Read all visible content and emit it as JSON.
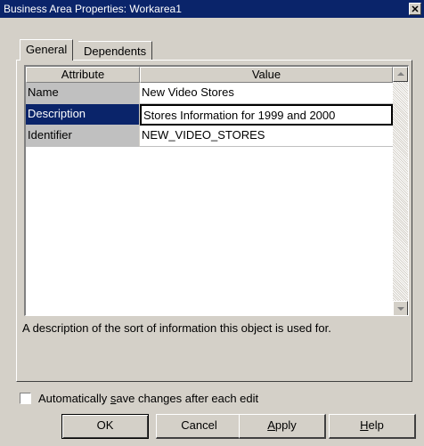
{
  "window": {
    "title": "Business Area Properties: Workarea1",
    "close_glyph": "✕"
  },
  "tabs": [
    {
      "label": "General",
      "active": true
    },
    {
      "label": "Dependents",
      "active": false
    }
  ],
  "grid": {
    "headers": {
      "attribute": "Attribute",
      "value": "Value"
    },
    "rows": [
      {
        "attribute": "Name",
        "value": "New Video Stores",
        "selected": false
      },
      {
        "attribute": "Description",
        "value": "Stores Information for 1999 and 2000",
        "selected": true
      },
      {
        "attribute": "Identifier",
        "value": "NEW_VIDEO_STORES",
        "selected": false
      }
    ]
  },
  "description_text": "A description of the sort of information this object is used for.",
  "autosave": {
    "checked": false,
    "label_pre": "Automatically ",
    "label_ul": "s",
    "label_post": "ave changes after each edit"
  },
  "buttons": {
    "ok": "OK",
    "cancel": "Cancel",
    "apply_ul": "A",
    "apply_rest": "pply",
    "help_ul": "H",
    "help_rest": "elp"
  },
  "colors": {
    "titlebar": "#0a246a",
    "selection": "#0a246a",
    "face": "#d4d0c8"
  },
  "icons": {
    "scroll_up": "up-arrow",
    "scroll_down": "down-arrow",
    "close": "close-x"
  }
}
